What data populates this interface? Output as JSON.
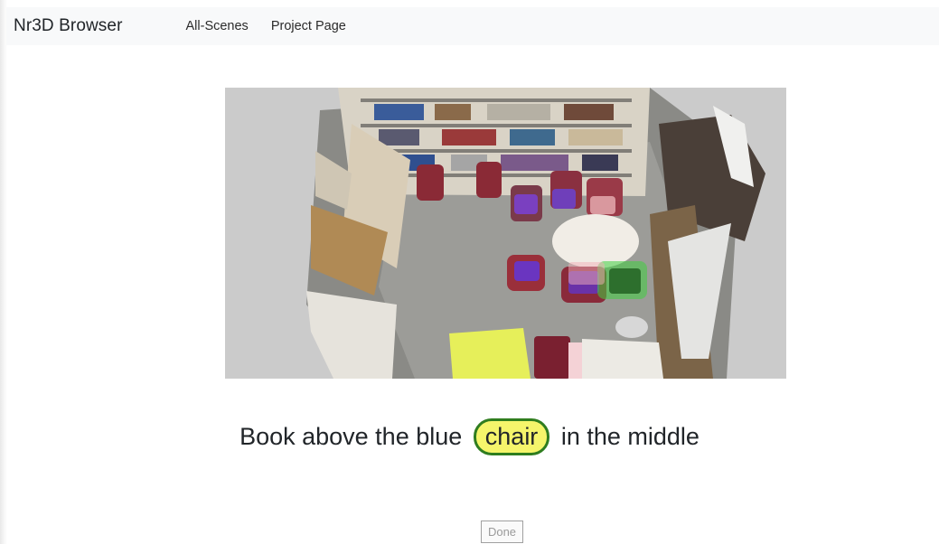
{
  "navbar": {
    "brand": "Nr3D Browser",
    "links": [
      "All-Scenes",
      "Project Page"
    ]
  },
  "scene": {
    "description_target": "chair",
    "utterance_before": "Book above the blue",
    "utterance_target": "chair",
    "utterance_after": "in the middle"
  },
  "controls": {
    "done_label": "Done"
  },
  "colors": {
    "navbar_bg": "#f8f9fa",
    "target_highlight": "#f5f56b",
    "target_border": "#2f7d1f",
    "scene_bg": "#cbcbcb"
  }
}
